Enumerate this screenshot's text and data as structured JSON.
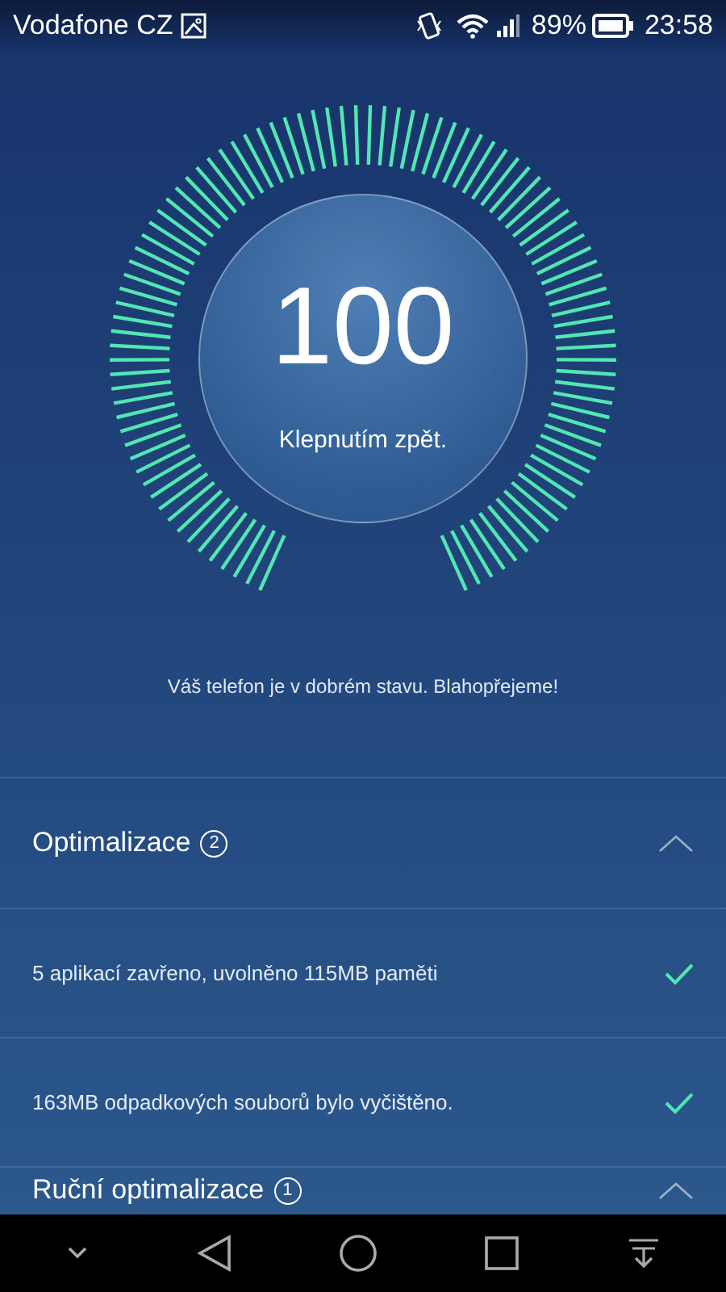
{
  "status_bar": {
    "carrier": "Vodafone CZ",
    "battery": "89%",
    "time": "23:58"
  },
  "score": {
    "value": "100",
    "caption": "Klepnutím zpět."
  },
  "message": "Váš telefon je v dobrém stavu. Blahopřejeme!",
  "sections": [
    {
      "title": "Optimalizace",
      "count": "2",
      "expanded": true,
      "items": [
        {
          "text": "5 aplikací zavřeno, uvolněno 115MB paměti",
          "done": true
        },
        {
          "text": "163MB odpadkových souborů bylo vyčištěno.",
          "done": true
        }
      ]
    },
    {
      "title": "Ruční optimalizace",
      "count": "1",
      "expanded": true
    }
  ]
}
